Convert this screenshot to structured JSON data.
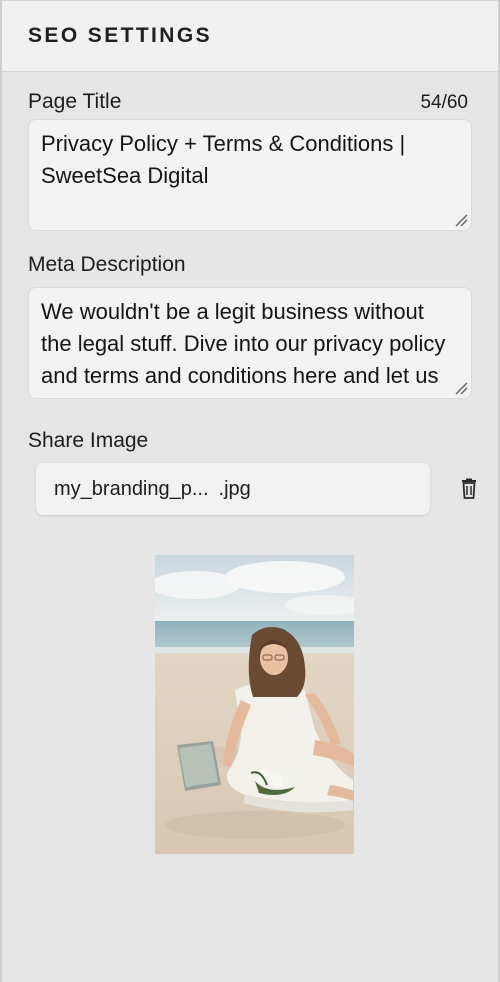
{
  "header": {
    "title": "SEO SETTINGS"
  },
  "page_title": {
    "label": "Page Title",
    "counter": "54/60",
    "value": "Privacy Policy + Terms & Conditions | SweetSea Digital"
  },
  "meta_description": {
    "label": "Meta Description",
    "value": "We wouldn't be a legit business without the legal stuff. Dive into our privacy policy and terms and conditions here and let us know if you have any questions."
  },
  "share_image": {
    "label": "Share Image",
    "filename_start": "my_branding_p...",
    "filename_ext": ".jpg",
    "delete_icon": "trash-icon"
  },
  "colors": {
    "panel_bg": "#e6e6e6",
    "header_bg": "#f2f1f1",
    "field_bg": "#f3f3f3"
  }
}
